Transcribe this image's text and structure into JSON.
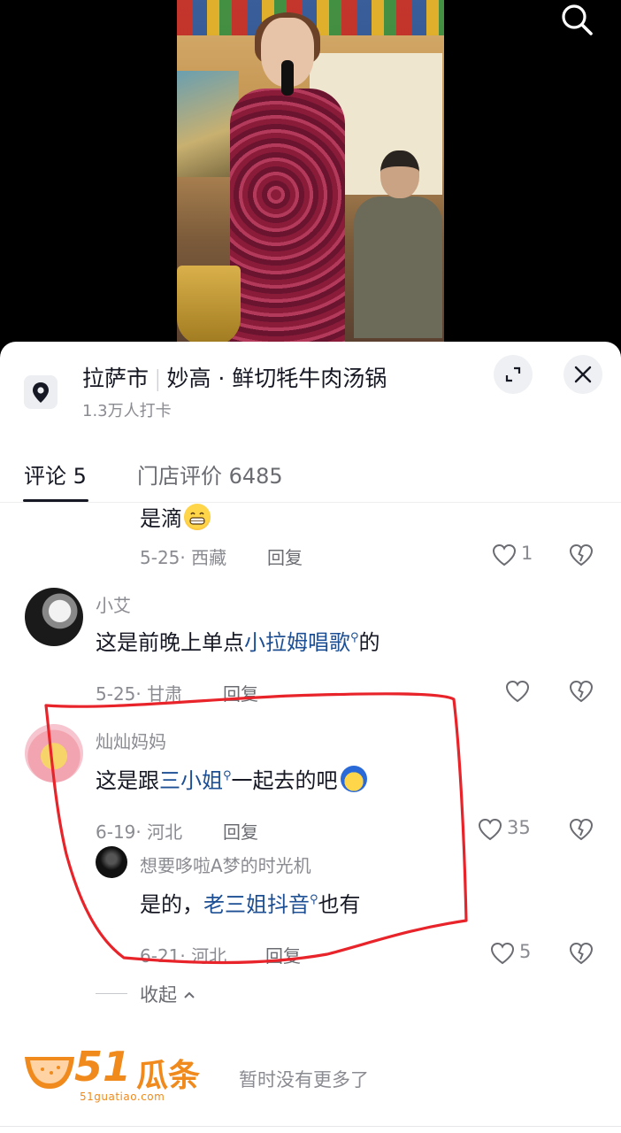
{
  "location": {
    "city": "拉萨市",
    "shop": "妙高 · 鲜切牦牛肉汤锅",
    "checkins": "1.3万人打卡"
  },
  "tabs": [
    {
      "label": "评论 5",
      "active": true
    },
    {
      "label": "门店评价 6485",
      "active": false
    }
  ],
  "comments": [
    {
      "text": "是滴",
      "date": "5-25",
      "region": "西藏",
      "reply": "回复",
      "likes": "1"
    },
    {
      "user": "小艾",
      "text_before": "这是前晚上单点",
      "link": "小拉姆唱歌",
      "text_after": "的",
      "date": "5-25",
      "region": "甘肃",
      "reply": "回复",
      "likes": ""
    },
    {
      "user": "灿灿妈妈",
      "text_before": "这是跟",
      "link": "三小姐",
      "text_after": "一起去的吧",
      "date": "6-19",
      "region": "河北",
      "reply": "回复",
      "likes": "35"
    },
    {
      "user": "想要哆啦A梦的时光机",
      "text_before": "是的，",
      "link": "老三姐抖音",
      "text_after": "也有",
      "date": "6-21",
      "region": "河北",
      "reply": "回复",
      "likes": "5"
    }
  ],
  "collapse_label": "收起",
  "no_more": "暂时没有更多了",
  "watermark": {
    "num": "51",
    "cn": "瓜条",
    "url": "51guatiao.com"
  },
  "colors": {
    "link": "#1c4f94",
    "annotation": "#e8242a",
    "watermark": "#f08a1c"
  },
  "icons": [
    "search-icon",
    "location-pin-icon",
    "collapse-icon",
    "close-icon",
    "heart-icon",
    "heart-break-icon",
    "chevron-up-icon"
  ]
}
